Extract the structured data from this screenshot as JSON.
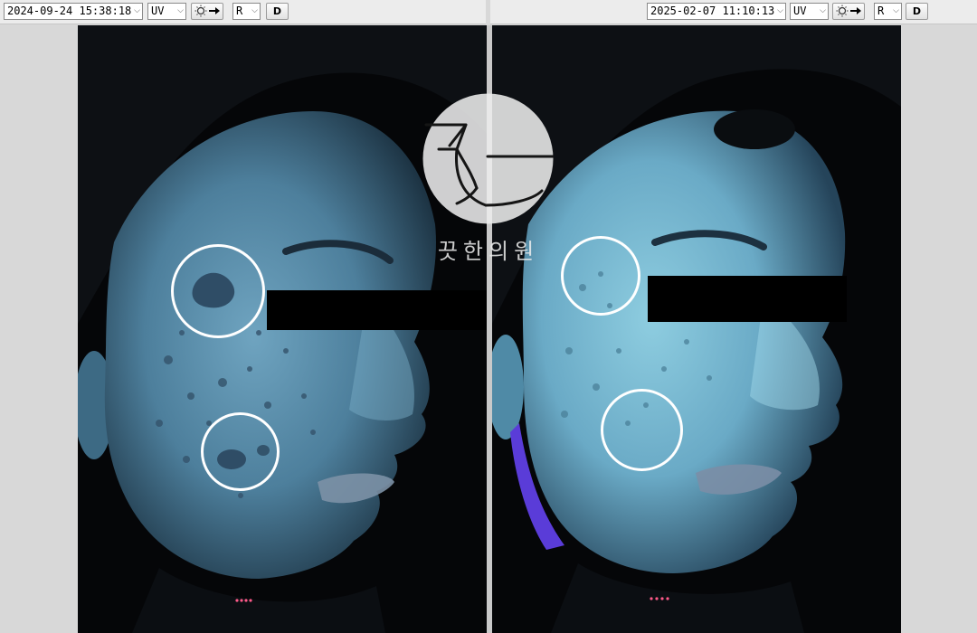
{
  "left": {
    "timestamp": "2024-09-24 15:38:18",
    "mode": "UV",
    "side": "R",
    "d_label": "D"
  },
  "right": {
    "timestamp": "2025-02-07 11:10:13",
    "mode": "UV",
    "side": "R",
    "d_label": "D"
  },
  "watermark": {
    "clinic_name": "끗한의원"
  },
  "icons": {
    "dropdown": "chevron-down-icon",
    "light_export": "bulb-arrow-icon"
  },
  "colors": {
    "toolbar_bg": "#ececec",
    "photo_bg": "#050608",
    "skin_uv": "#5f95b0",
    "ring": "#ffffff"
  }
}
